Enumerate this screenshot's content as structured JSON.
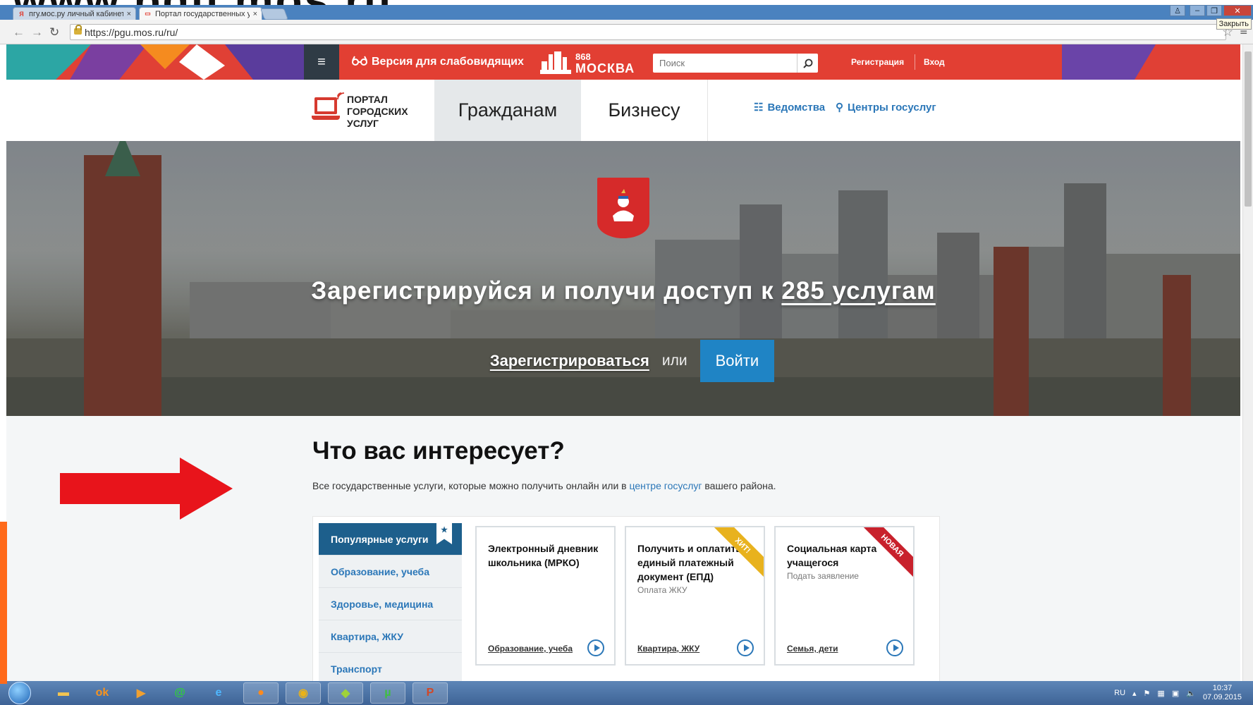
{
  "slide": {
    "title_fragment": "www.pgu.mos.ru"
  },
  "browser": {
    "tabs": [
      {
        "label": "пгу.мос.ру личный кабинет",
        "active": false
      },
      {
        "label": "Портал государственных услуг",
        "active": true
      }
    ],
    "url": "https://pgu.mos.ru/ru/",
    "tooltip": "Закрыть"
  },
  "header": {
    "low_vision": "Версия для слабовидящих",
    "moscow_logo": {
      "number": "868",
      "word": "МОСКВА"
    },
    "search_placeholder": "Поиск",
    "register": "Регистрация",
    "login": "Вход"
  },
  "nav": {
    "portal_logo": [
      "ПОРТАЛ",
      "ГОРОДСКИХ",
      "УСЛУГ"
    ],
    "tabs": [
      {
        "label": "Гражданам",
        "active": true
      },
      {
        "label": "Бизнесу",
        "active": false
      }
    ],
    "links": [
      "Ведомства",
      "Центры госуслуг"
    ]
  },
  "hero": {
    "title_prefix": "Зарегистрируйся и получи доступ к ",
    "title_link": "285 услугам",
    "register_link": "Зарегистрироваться",
    "or": "или",
    "login_button": "Войти"
  },
  "content": {
    "heading": "Что вас интересует?",
    "subline_before": "Все государственные услуги, которые можно получить онлайн или в ",
    "subline_link": "центре госуслуг",
    "subline_after": " вашего района.",
    "categories": [
      {
        "label": "Популярные услуги",
        "active": true
      },
      {
        "label": "Образование, учеба",
        "active": false
      },
      {
        "label": "Здоровье, медицина",
        "active": false
      },
      {
        "label": "Квартира, ЖКУ",
        "active": false
      },
      {
        "label": "Транспорт",
        "active": false
      }
    ],
    "cards": [
      {
        "title": "Электронный дневник школьника (МРКО)",
        "subtitle": "",
        "category": "Образование, учеба",
        "badge": ""
      },
      {
        "title": "Получить и оплатить единый платежный документ (ЕПД)",
        "subtitle": "Оплата ЖКУ",
        "category": "Квартира, ЖКУ",
        "badge": "ХИТ!"
      },
      {
        "title": "Социальная карта учащегося",
        "subtitle": "Подать заявление",
        "category": "Семья, дети",
        "badge": "НОВАЯ"
      }
    ]
  },
  "taskbar": {
    "apps": [
      "explorer",
      "odnoklassniki",
      "media-player",
      "mail-agent",
      "internet-explorer",
      "firefox",
      "chrome",
      "game",
      "utorrent",
      "powerpoint"
    ],
    "lang": "RU",
    "time": "10:37",
    "date": "07.09.2015"
  },
  "colors": {
    "brand_red": "#e04035",
    "link_blue": "#2b77b8",
    "button_blue": "#1f84c5",
    "active_category": "#1d5f8c"
  }
}
